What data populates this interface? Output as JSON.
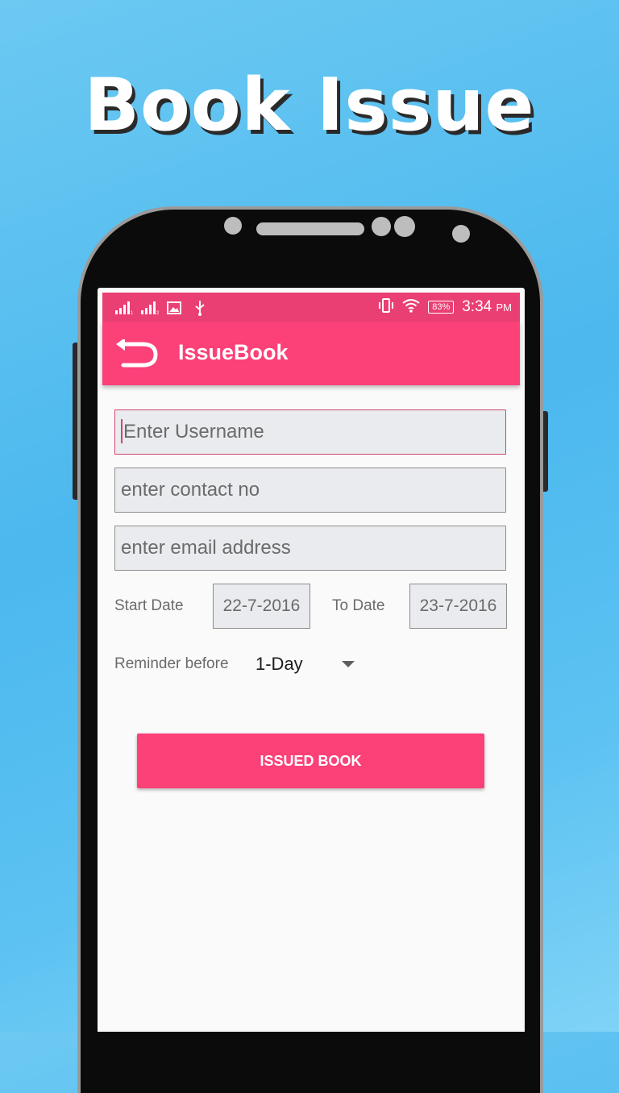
{
  "promo": {
    "title": "Book Issue"
  },
  "statusbar": {
    "time": "3:34",
    "ampm": "PM",
    "battery": "83%",
    "icons_left": [
      "signal-1-icon",
      "signal-2-icon",
      "image-icon",
      "usb-icon"
    ],
    "icons_right": [
      "vibrate-icon",
      "wifi-icon",
      "battery-icon"
    ]
  },
  "appbar": {
    "title": "IssueBook",
    "back_icon": "back-arrow-icon"
  },
  "form": {
    "username_placeholder": "Enter Username",
    "contact_placeholder": "enter contact no",
    "email_placeholder": "enter email address",
    "start_label": "Start Date",
    "start_value": "22-7-2016",
    "to_label": "To Date",
    "to_value": "23-7-2016",
    "reminder_label": "Reminder before",
    "reminder_value": "1-Day",
    "submit_label": "ISSUED BOOK"
  },
  "colors": {
    "accent": "#fc4078",
    "statusbar": "#ea3f73",
    "background": "#4bb8ee"
  }
}
